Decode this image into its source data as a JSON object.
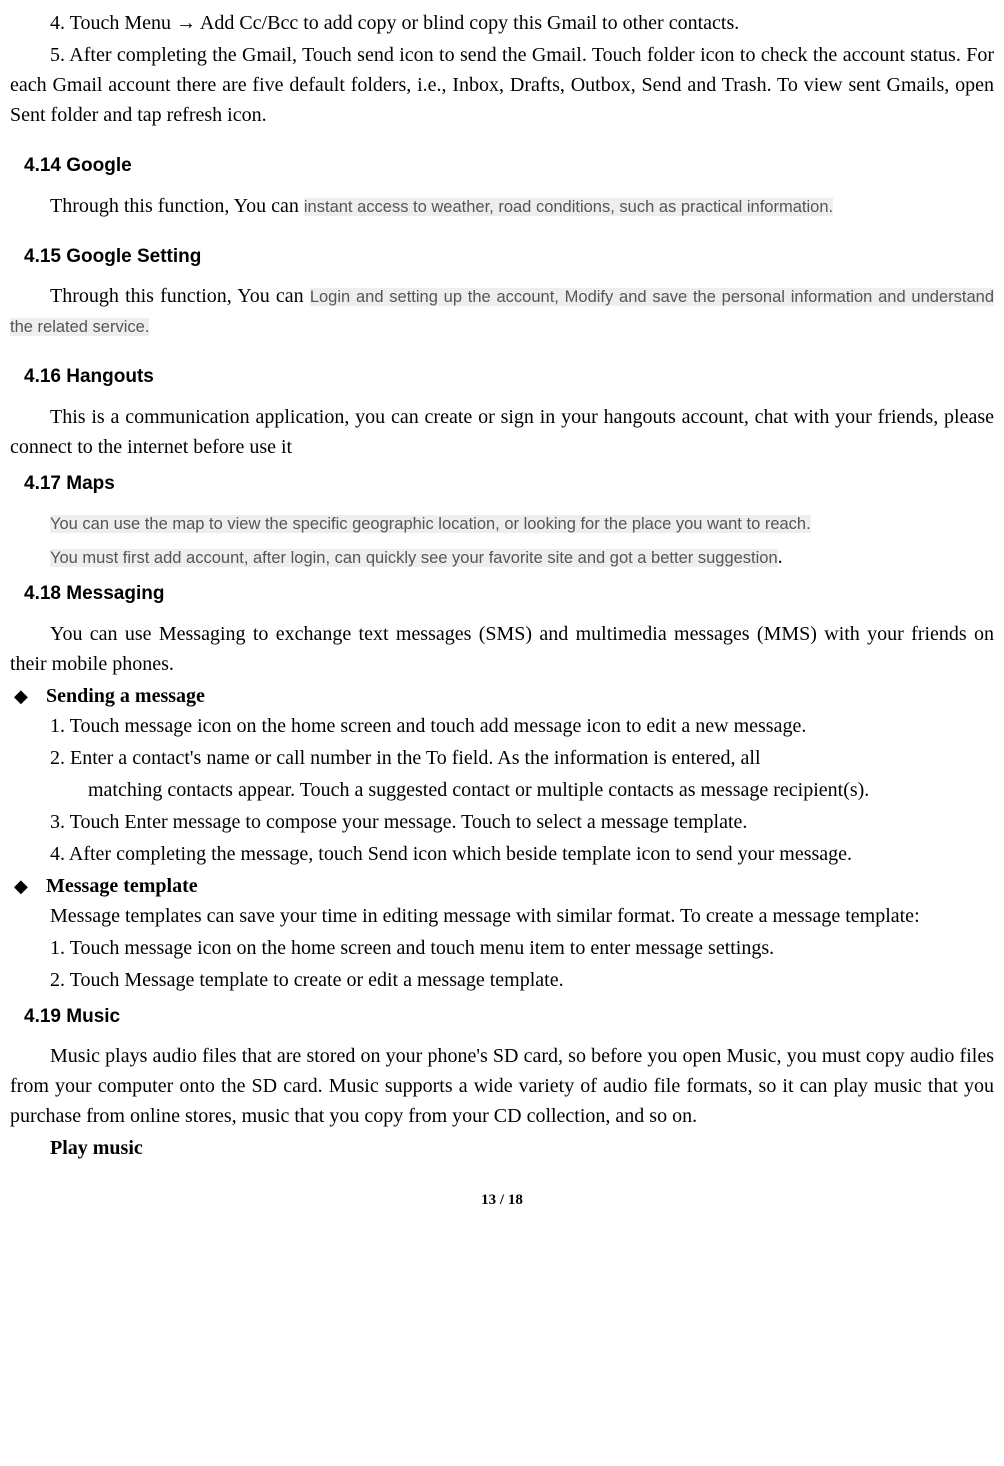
{
  "intro": {
    "item4": "4.    Touch Menu  →  Add Cc/Bcc to add copy or blind copy this Gmail to other contacts.",
    "item5": "5.   After completing the Gmail, Touch send icon to send the Gmail. Touch folder icon to check the account status. For each Gmail account there are five default folders, i.e., Inbox, Drafts, Outbox, Send and Trash. To view sent Gmails, open Sent folder and tap refresh icon."
  },
  "s414": {
    "heading": "4.14  Google",
    "prefix": "Through this function, You can ",
    "highlight": "instant access to weather, road conditions, such as practical information."
  },
  "s415": {
    "heading": "4.15  Google Setting",
    "prefix": "Through this function, You can ",
    "highlight": "Login and setting up the account, Modify and save the personal information and understand the related service."
  },
  "s416": {
    "heading": "4.16  Hangouts",
    "body": "This is a communication application, you can create or sign in your hangouts account, chat with your friends, please connect to the internet before use it"
  },
  "s417": {
    "heading": "4.17  Maps",
    "line1": "You can use the map to view the specific geographic location, or looking for the place you want to reach.",
    "line2": "You must first add account, after login, can quickly see your favorite site and got a better suggestion",
    "period": "."
  },
  "s418": {
    "heading": "4.18  Messaging",
    "intro": "You can use Messaging to exchange text messages (SMS) and multimedia messages (MMS) with your friends on their mobile phones.",
    "sub1_title": "Sending a message",
    "sub1_items": {
      "i1": "1.   Touch message icon on the home screen and touch add message icon to edit a new message.",
      "i2a": "2.   Enter a contact's name or call number in the To field. As the information is entered, all",
      "i2b": "matching contacts appear. Touch a suggested contact or multiple contacts as message recipient(s).",
      "i3": "3.    Touch Enter message to compose your message. Touch to select a message template.",
      "i4": "4.    After completing the message, touch Send icon which beside template icon to send your message."
    },
    "sub2_title": "Message template",
    "sub2_intro": "Message templates can save your time in editing message with similar format. To create a message template:",
    "sub2_items": {
      "i1": "1.    Touch message icon on the home screen and touch menu item to enter message settings.",
      "i2": "2.    Touch Message template to create or edit a message template."
    }
  },
  "s419": {
    "heading": "4.19  Music",
    "body": "Music plays audio files that are stored on your phone's SD card, so before you open Music, you must copy audio files from your computer onto the SD card. Music supports a wide variety of audio file formats, so it can play music that you purchase from online stores, music that you copy from your CD collection, and so on.",
    "sub": "Play music"
  },
  "footer": "13 / 18"
}
